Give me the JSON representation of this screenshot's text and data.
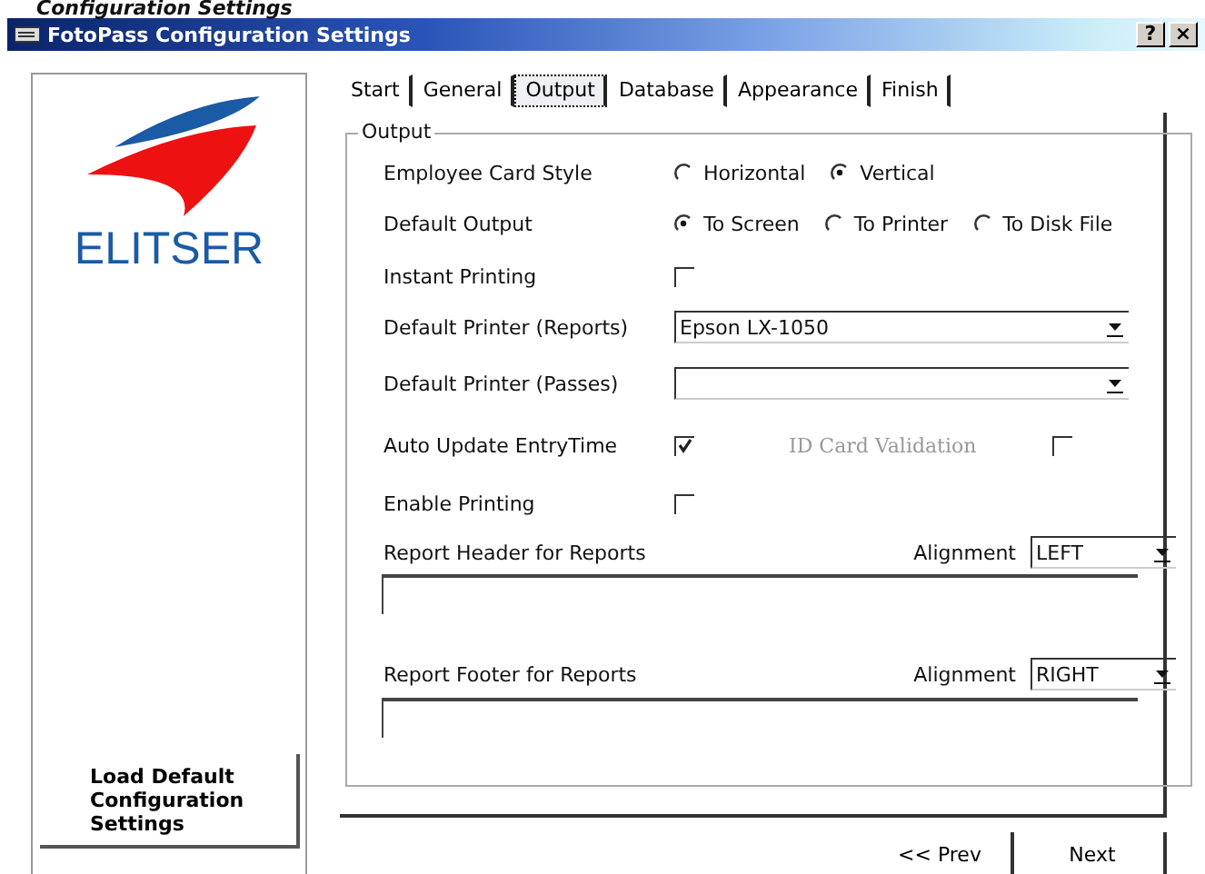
{
  "heading": "Configuration Settings",
  "window": {
    "title": "FotoPass Configuration Settings",
    "help_button": "?",
    "close_button": "×"
  },
  "tabs": [
    {
      "label": "Start",
      "selected": false
    },
    {
      "label": "General",
      "selected": false
    },
    {
      "label": "Output",
      "selected": true
    },
    {
      "label": "Database",
      "selected": false
    },
    {
      "label": "Appearance",
      "selected": false
    },
    {
      "label": "Finish",
      "selected": false
    }
  ],
  "sidebar": {
    "logo_text": "ELITSER",
    "load_defaults_button": "Load Default Configuration Settings"
  },
  "group": {
    "title": "Output",
    "rows": [
      {
        "kind": "radio",
        "label": "Employee Card Style",
        "options": [
          {
            "label": "Horizontal",
            "selected": false
          },
          {
            "label": "Vertical",
            "selected": true
          }
        ]
      },
      {
        "kind": "radio",
        "label": "Default Output",
        "options": [
          {
            "label": "To Screen",
            "selected": true
          },
          {
            "label": "To Printer",
            "selected": false
          },
          {
            "label": "To Disk File",
            "selected": false
          }
        ]
      },
      {
        "kind": "checkbox",
        "label": "Instant Printing",
        "checked": false
      },
      {
        "kind": "select",
        "label": "Default Printer (Reports)",
        "value": "Epson LX-1050"
      },
      {
        "kind": "select",
        "label": "Default Printer (Passes)"
      },
      {
        "kind": "checkbox",
        "label": "Auto Update EntryTime",
        "checked": true,
        "extra": {
          "label": "ID Card Validation",
          "checked": false,
          "disabled": true
        }
      },
      {
        "kind": "checkbox",
        "label": "Enable Printing",
        "checked": false
      },
      {
        "kind": "text",
        "label": "Report Header for Reports",
        "alignment_label": "Alignment",
        "alignment": "LEFT"
      },
      {
        "kind": "text",
        "label": "Report Footer for Reports",
        "alignment_label": "Alignment",
        "alignment": "RIGHT"
      }
    ]
  },
  "buttons": [
    {
      "label": "<< Prev"
    },
    {
      "label": "Next"
    }
  ]
}
